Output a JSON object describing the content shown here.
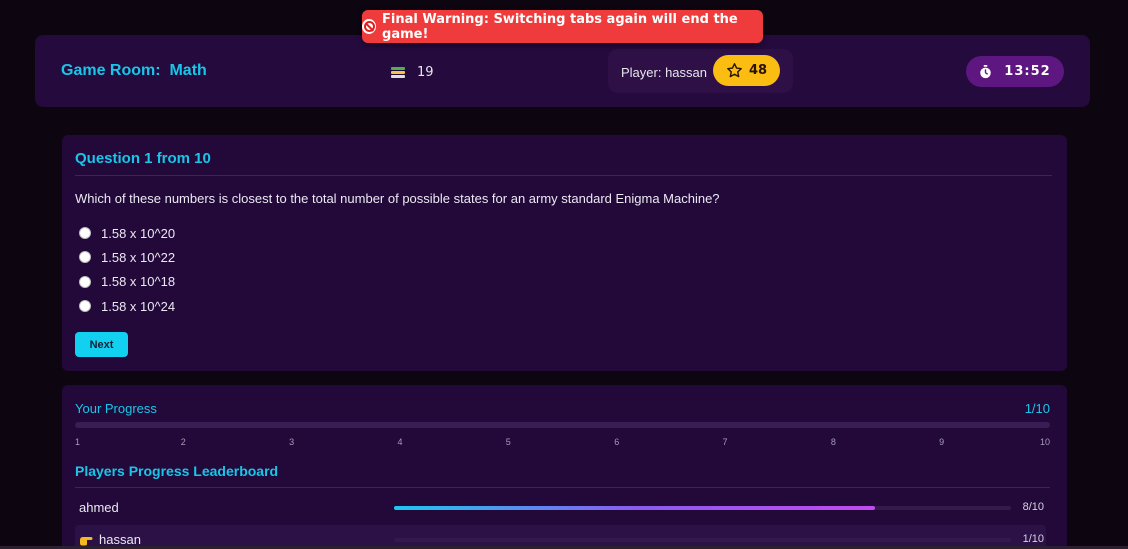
{
  "toast": {
    "text": "Final Warning: Switching tabs again will end the game!",
    "icon": "ban-icon",
    "color": "#ef3b3b"
  },
  "header": {
    "room_title": "Game Room:  Math",
    "question_count": "19",
    "question_count_icon": "books-icon",
    "player_label": "Player: hassan",
    "score": "48",
    "score_icon": "star-icon",
    "timer": "13:52",
    "timer_icon": "stopwatch-icon"
  },
  "question": {
    "title": "Question 1 from 10",
    "text": "Which of these numbers is closest to the total number of possible states for an army standard Enigma Machine?",
    "options": [
      "1.58 x 10^20",
      "1.58 x 10^22",
      "1.58 x 10^18",
      "1.58 x 10^24"
    ],
    "next_label": "Next"
  },
  "progress": {
    "title": "Your Progress",
    "value_text": "1/10",
    "fraction": 0,
    "ticks": [
      "1",
      "2",
      "3",
      "4",
      "5",
      "6",
      "7",
      "8",
      "9",
      "10"
    ]
  },
  "leaderboard": {
    "title": "Players Progress Leaderboard",
    "rows": [
      {
        "name": "ahmed",
        "count": "8/10",
        "fraction": 0.78,
        "is_me": false
      },
      {
        "name": "hassan",
        "count": "1/10",
        "fraction": 0,
        "is_me": true
      }
    ]
  },
  "colors": {
    "accent": "#19c6e8",
    "score": "#fbbd12",
    "timer": "#5e1780",
    "background": "#0d0510",
    "card": "#22093a"
  }
}
